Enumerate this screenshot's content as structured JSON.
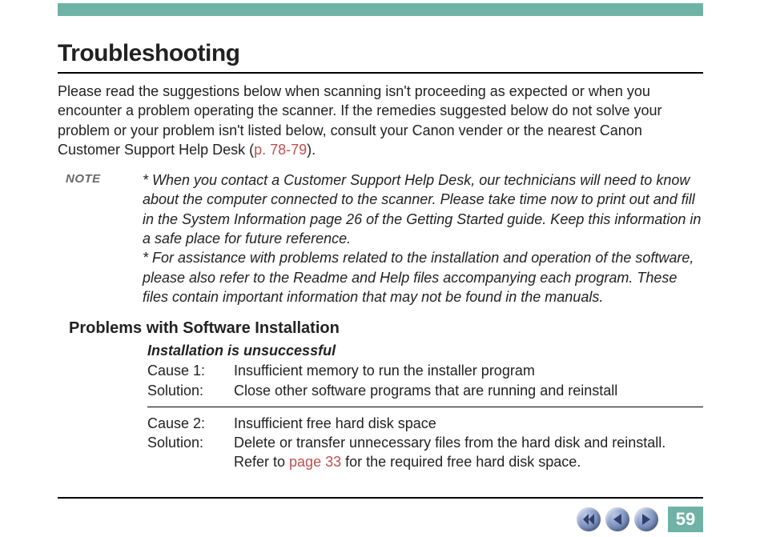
{
  "title": "Troubleshooting",
  "intro_part1": "Please read the suggestions below when scanning isn't proceeding as expected or when you encounter a problem operating the scanner. If the remedies suggested below do not solve your problem or your problem isn't listed below, consult your Canon vender or the nearest Canon Customer Support Help Desk (",
  "intro_link": "p. 78-79",
  "intro_part2": ").",
  "note_label": "NOTE",
  "note1": "*   When you contact a Customer Support Help Desk, our technicians will need to know about the computer connected to the scanner. Please take time now to print out and fill in the System Information page 26 of the Getting Started guide. Keep this information in a safe place for future reference.",
  "note2": "*   For assistance with problems related to the installation and operation of the software, please also refer to the Readme and Help files accompanying each program. These files contain important information that may not be found in the manuals.",
  "section_heading": "Problems with Software Installation",
  "subsection_heading": "Installation is unsuccessful",
  "rows": {
    "c1_label": "Cause 1:",
    "c1_text": "Insufficient memory to run the installer program",
    "s1_label": "Solution:",
    "s1_text": "Close other software programs that are running and reinstall",
    "c2_label": "Cause 2:",
    "c2_text": "Insufficient free hard disk space",
    "s2_label": "Solution:",
    "s2_text_a": "Delete or transfer unnecessary files from the hard disk and reinstall. Refer to ",
    "s2_link": "page 33",
    "s2_text_b": " for the required free hard disk space."
  },
  "page_number": "59"
}
